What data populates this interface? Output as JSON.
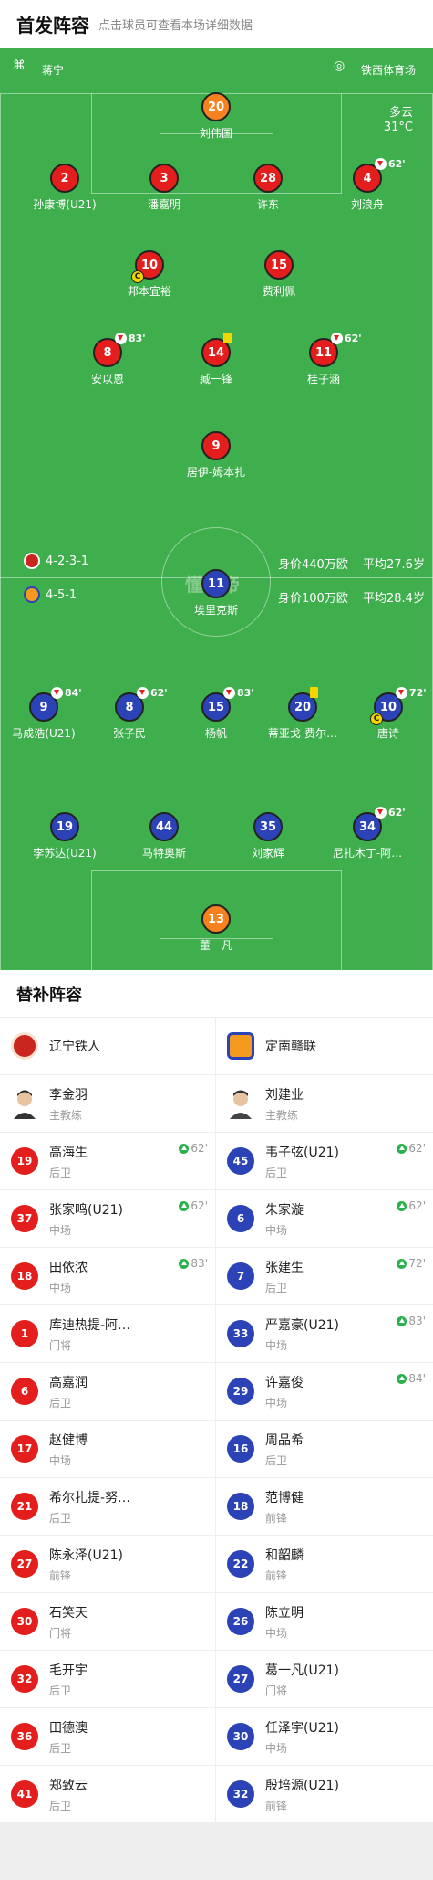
{
  "header": {
    "title": "首发阵容",
    "subtitle": "点击球员可查看本场详细数据"
  },
  "field": {
    "coach_label": "蒋宁",
    "stadium": "铁西体育场",
    "weather": "多云",
    "temperature": "31°C",
    "watermark": "懂球帝",
    "home": {
      "formation": "4-2-3-1",
      "value": "身价440万欧",
      "age": "平均27.6岁"
    },
    "away": {
      "formation": "4-5-1",
      "value": "身价100万欧",
      "age": "平均28.4岁"
    },
    "home_players": [
      {
        "num": "20",
        "name": "刘伟国",
        "color": "orange"
      },
      {
        "num": "2",
        "name": "孙康博(U21)",
        "color": "red"
      },
      {
        "num": "3",
        "name": "潘嘉明",
        "color": "red"
      },
      {
        "num": "28",
        "name": "许东",
        "color": "red"
      },
      {
        "num": "4",
        "name": "刘浪舟",
        "color": "red",
        "sub": "62'"
      },
      {
        "num": "10",
        "name": "邦本宜裕",
        "color": "red",
        "captain": "C"
      },
      {
        "num": "15",
        "name": "费利佩",
        "color": "red"
      },
      {
        "num": "8",
        "name": "安以恩",
        "color": "red",
        "sub": "83'"
      },
      {
        "num": "14",
        "name": "臧一锋",
        "color": "red",
        "yellow": true
      },
      {
        "num": "11",
        "name": "桂子涵",
        "color": "red",
        "sub": "62'"
      },
      {
        "num": "9",
        "name": "居伊-姆本扎",
        "color": "red"
      }
    ],
    "away_players": [
      {
        "num": "11",
        "name": "埃里克斯",
        "color": "blue"
      },
      {
        "num": "9",
        "name": "马成浩(U21)",
        "color": "blue",
        "sub": "84'"
      },
      {
        "num": "8",
        "name": "张子民",
        "color": "blue",
        "sub": "62'"
      },
      {
        "num": "15",
        "name": "杨帆",
        "color": "blue",
        "sub": "83'"
      },
      {
        "num": "20",
        "name": "蒂亚戈-费尔…",
        "color": "blue",
        "yellow": true
      },
      {
        "num": "10",
        "name": "唐诗",
        "color": "blue",
        "sub": "72'",
        "captain": "C"
      },
      {
        "num": "19",
        "name": "李苏达(U21)",
        "color": "blue"
      },
      {
        "num": "44",
        "name": "马特奥斯",
        "color": "blue"
      },
      {
        "num": "35",
        "name": "刘家辉",
        "color": "blue"
      },
      {
        "num": "34",
        "name": "尼扎木丁-阿…",
        "color": "blue",
        "sub": "62'"
      },
      {
        "num": "13",
        "name": "董一凡",
        "color": "orange"
      }
    ]
  },
  "bench": {
    "title": "替补阵容",
    "home": {
      "team": "辽宁铁人",
      "coach": {
        "name": "李金羽",
        "role": "主教练"
      },
      "players": [
        {
          "num": "19",
          "name": "高海生",
          "pos": "后卫",
          "sub": "62'"
        },
        {
          "num": "37",
          "name": "张家鸣(U21)",
          "pos": "中场",
          "sub": "62'"
        },
        {
          "num": "18",
          "name": "田依浓",
          "pos": "中场",
          "sub": "83'"
        },
        {
          "num": "1",
          "name": "库迪热提-阿…",
          "pos": "门将"
        },
        {
          "num": "6",
          "name": "高嘉润",
          "pos": "后卫"
        },
        {
          "num": "17",
          "name": "赵健博",
          "pos": "中场"
        },
        {
          "num": "21",
          "name": "希尔扎提-努…",
          "pos": "后卫"
        },
        {
          "num": "27",
          "name": "陈永泽(U21)",
          "pos": "前锋"
        },
        {
          "num": "30",
          "name": "石笑天",
          "pos": "门将"
        },
        {
          "num": "32",
          "name": "毛开宇",
          "pos": "后卫"
        },
        {
          "num": "36",
          "name": "田德澳",
          "pos": "后卫"
        },
        {
          "num": "41",
          "name": "郑致云",
          "pos": "后卫"
        }
      ]
    },
    "away": {
      "team": "定南赣联",
      "coach": {
        "name": "刘建业",
        "role": "主教练"
      },
      "players": [
        {
          "num": "45",
          "name": "韦子弦(U21)",
          "pos": "后卫",
          "sub": "62'"
        },
        {
          "num": "6",
          "name": "朱家漩",
          "pos": "中场",
          "sub": "62'"
        },
        {
          "num": "7",
          "name": "张建生",
          "pos": "后卫",
          "sub": "72'"
        },
        {
          "num": "33",
          "name": "严嘉豪(U21)",
          "pos": "中场",
          "sub": "83'"
        },
        {
          "num": "29",
          "name": "许嘉俊",
          "pos": "中场",
          "sub": "84'"
        },
        {
          "num": "16",
          "name": "周品希",
          "pos": "后卫"
        },
        {
          "num": "18",
          "name": "范博健",
          "pos": "前锋"
        },
        {
          "num": "22",
          "name": "和韶麟",
          "pos": "前锋"
        },
        {
          "num": "26",
          "name": "陈立明",
          "pos": "中场"
        },
        {
          "num": "27",
          "name": "葛一凡(U21)",
          "pos": "门将"
        },
        {
          "num": "30",
          "name": "任泽宇(U21)",
          "pos": "中场"
        },
        {
          "num": "32",
          "name": "殷培源(U21)",
          "pos": "前锋"
        }
      ]
    }
  },
  "colors": {
    "pitch": "#3fae4d",
    "home": "#e41d1d",
    "away": "#2c43b8",
    "gk": "#f5821f",
    "sub_green": "#2bb24c"
  }
}
